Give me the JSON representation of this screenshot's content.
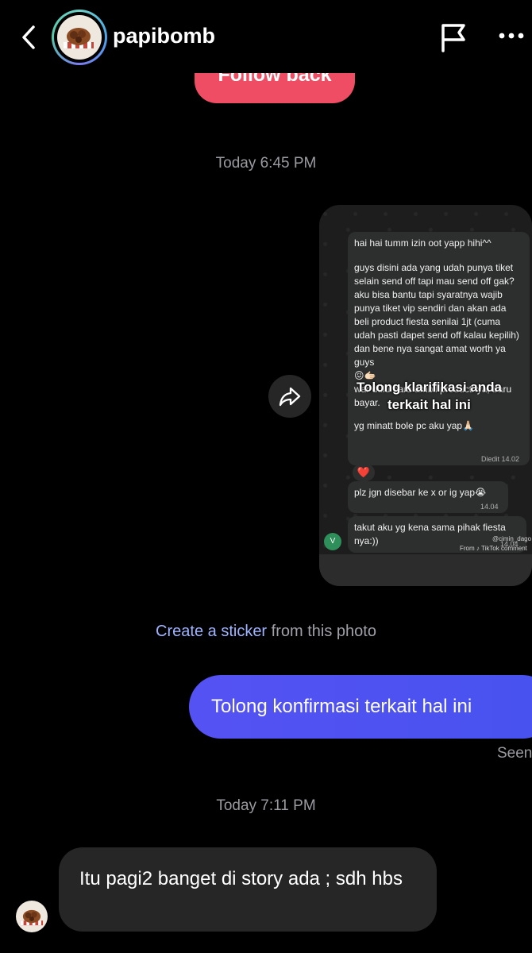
{
  "header": {
    "username": "papibomb",
    "back_icon": "chevron-left-icon",
    "flag_icon": "flag-icon",
    "more_icon": "more-horizontal-icon",
    "avatar_ring_colors": [
      "#6fd0c7",
      "#4aa3e8",
      "#7b7bf0"
    ]
  },
  "follow_back": {
    "label": "Follow back",
    "color": "#ef4d63"
  },
  "timestamps": {
    "first": "Today 6:45 PM",
    "second": "Today 7:11 PM"
  },
  "shared_photo": {
    "share_icon": "forward-arrow-icon",
    "screenshot": {
      "message_main": {
        "line1": "hai hai tumm izin oot yapp hihi^^",
        "body": "guys disini ada yang udah punya tiket selain send off tapi mau send off gak? aku bisa bantu tapi syaratnya wajib punya tiket vip sendiri dan akan ada beli product fiesta senilai 1jt (cuma udah pasti dapet send off kalau kepilih) dan bene nya sangat amat worth ya guys",
        "emoji_line": "😖🫱🏻",
        "tail": "war dulu baru ambil productnya, baru bayar.",
        "closing": "yg minatt bole pc aku yap🙏🏻",
        "meta": "Diedit 14.02"
      },
      "overlay_caption": [
        "Tolong klarifikasi anda",
        "terkait hal ini"
      ],
      "reaction": "❤️",
      "message_2": {
        "text": "plz jgn disebar ke x or ig yap😭",
        "meta": "14.04"
      },
      "message_3": {
        "text": "takut aku yg kena sama pihak fiesta nya:))",
        "meta": "14.04"
      },
      "avatar_letter": "V",
      "watermark_handle": "@cimin_dago",
      "watermark_source": "From ♪ TikTok comment"
    }
  },
  "sticker": {
    "link": "Create a sticker",
    "rest": " from this photo"
  },
  "my_message": {
    "text": "Tolong konfirmasi terkait hal ini",
    "status": "Seen"
  },
  "their_message": {
    "text": "Itu pagi2 banget di story ada ; sdh hbs"
  }
}
